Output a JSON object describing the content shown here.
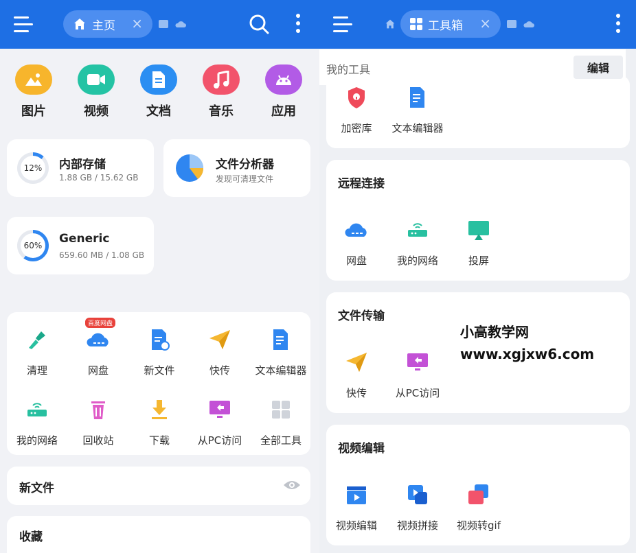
{
  "left": {
    "tab_label": "主页",
    "categories": [
      {
        "label": "图片",
        "color": "#f7b52c"
      },
      {
        "label": "视频",
        "color": "#24c3a4"
      },
      {
        "label": "文档",
        "color": "#2b8ef2"
      },
      {
        "label": "音乐",
        "color": "#f2536b"
      },
      {
        "label": "应用",
        "color": "#b25be6"
      }
    ],
    "storage": {
      "title": "内部存储",
      "percent": "12%",
      "fraction": 0.12,
      "detail": "1.88 GB / 15.62 GB"
    },
    "analyzer": {
      "title": "文件分析器",
      "subtitle": "发现可清理文件"
    },
    "generic": {
      "title": "Generic",
      "percent": "60%",
      "fraction": 0.6,
      "detail": "659.60 MB / 1.08 GB"
    },
    "badge": "百度网盘",
    "tools": [
      "清理",
      "网盘",
      "新文件",
      "快传",
      "文本编辑器",
      "我的网络",
      "回收站",
      "下载",
      "从PC访问",
      "全部工具"
    ],
    "recent_title": "新文件",
    "favorites_title": "收藏"
  },
  "right": {
    "tab_label": "工具箱",
    "my_tools": "我的工具",
    "edit": "编辑",
    "section0_tools": [
      "加密库",
      "文本编辑器"
    ],
    "sections": [
      {
        "title": "远程连接",
        "tools": [
          "网盘",
          "我的网络",
          "投屏"
        ]
      },
      {
        "title": "文件传输",
        "tools": [
          "快传",
          "从PC访问"
        ]
      },
      {
        "title": "视频编辑",
        "tools": [
          "视频编辑",
          "视频拼接",
          "视频转gif"
        ]
      }
    ]
  },
  "watermark": {
    "line1": "小高教学网",
    "line2": "www.xgjxw6.com"
  }
}
